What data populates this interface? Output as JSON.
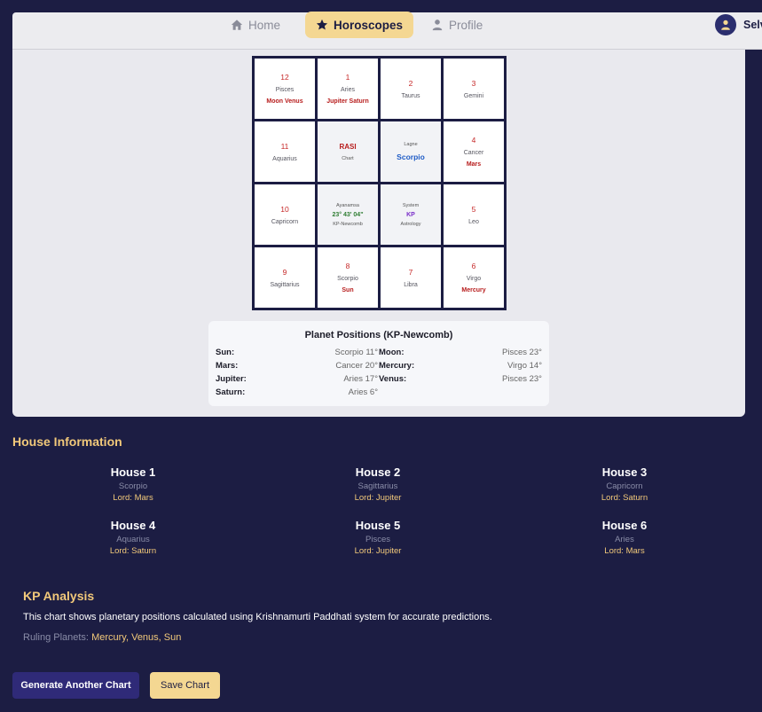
{
  "nav": {
    "home": "Home",
    "horoscopes": "Horoscopes",
    "profile": "Profile",
    "user": "Selv"
  },
  "chart": {
    "cells": [
      {
        "num": "12",
        "sign": "Pisces",
        "planets": "Moon Venus"
      },
      {
        "num": "1",
        "sign": "Aries",
        "planets": "Jupiter Saturn"
      },
      {
        "num": "2",
        "sign": "Taurus",
        "planets": ""
      },
      {
        "num": "3",
        "sign": "Gemini",
        "planets": ""
      },
      {
        "num": "11",
        "sign": "Aquarius",
        "planets": ""
      },
      {
        "num": "4",
        "sign": "Cancer",
        "planets": "Mars"
      },
      {
        "num": "10",
        "sign": "Capricorn",
        "planets": ""
      },
      {
        "num": "5",
        "sign": "Leo",
        "planets": ""
      },
      {
        "num": "9",
        "sign": "Sagittarius",
        "planets": ""
      },
      {
        "num": "8",
        "sign": "Scorpio",
        "planets": "Sun"
      },
      {
        "num": "7",
        "sign": "Libra",
        "planets": ""
      },
      {
        "num": "6",
        "sign": "Virgo",
        "planets": "Mercury"
      }
    ],
    "center": {
      "rasi_title": "RASI",
      "rasi_sub": "Chart",
      "lagne_label": "Lagne",
      "lagne_value": "Scorpio",
      "ayanamsa_label": "Ayanamsa",
      "ayanamsa_value": "23° 43' 04\"",
      "ayanamsa_system": "KP-Newcomb",
      "system_label": "System",
      "system_value": "KP",
      "system_sub": "Astrology"
    }
  },
  "positions": {
    "title": "Planet Positions (KP-Newcomb)",
    "rows": [
      {
        "name": "Sun:",
        "value": "Scorpio 11°",
        "name2": "Moon:",
        "value2": "Pisces 23°"
      },
      {
        "name": "Mars:",
        "value": "Cancer 20°",
        "name2": "Mercury:",
        "value2": "Virgo 14°"
      },
      {
        "name": "Jupiter:",
        "value": "Aries 17°",
        "name2": "Venus:",
        "value2": "Pisces 23°"
      },
      {
        "name": "Saturn:",
        "value": "Aries 6°",
        "name2": "",
        "value2": ""
      }
    ]
  },
  "house_info": {
    "title": "House Information",
    "houses": [
      {
        "name": "House 1",
        "sign": "Scorpio",
        "lord": "Lord: Mars"
      },
      {
        "name": "House 2",
        "sign": "Sagittarius",
        "lord": "Lord: Jupiter"
      },
      {
        "name": "House 3",
        "sign": "Capricorn",
        "lord": "Lord: Saturn"
      },
      {
        "name": "House 4",
        "sign": "Aquarius",
        "lord": "Lord: Saturn"
      },
      {
        "name": "House 5",
        "sign": "Pisces",
        "lord": "Lord: Jupiter"
      },
      {
        "name": "House 6",
        "sign": "Aries",
        "lord": "Lord: Mars"
      }
    ]
  },
  "kp": {
    "title": "KP Analysis",
    "text": "This chart shows planetary positions calculated using Krishnamurti Paddhati system for accurate predictions.",
    "ruling_label": "Ruling Planets:",
    "ruling_value": "Mercury, Venus, Sun"
  },
  "actions": {
    "generate": "Generate Another Chart",
    "save": "Save Chart"
  }
}
